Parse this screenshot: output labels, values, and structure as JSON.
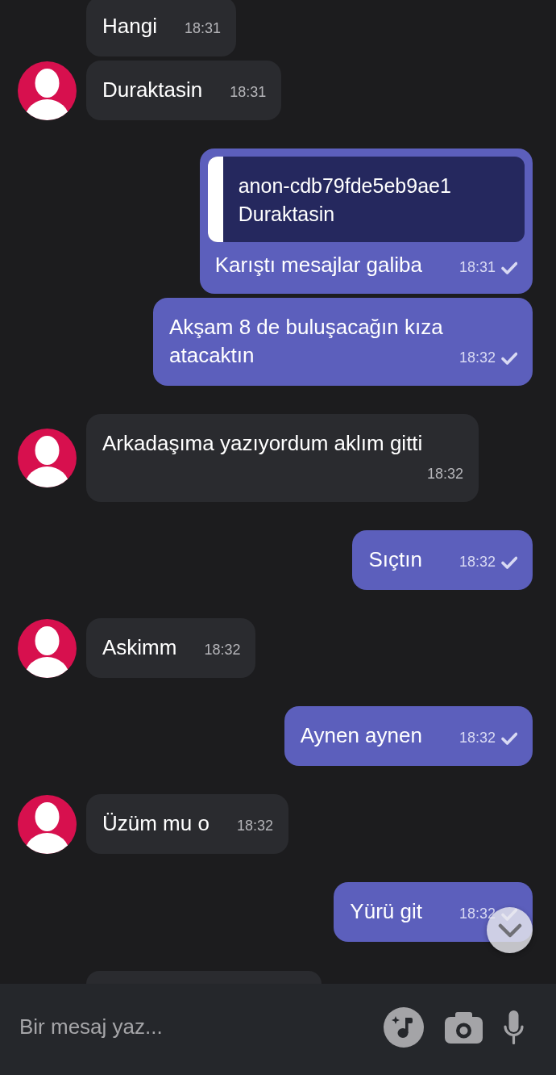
{
  "chat": {
    "groups": [
      {
        "kind": "incoming",
        "messages": [
          {
            "text": "Hangi",
            "time": "18:31"
          },
          {
            "text": "Duraktasin",
            "time": "18:31"
          }
        ]
      },
      {
        "kind": "outgoing",
        "messages": [
          {
            "reply_to": {
              "author": "anon-cdb79fde5eb9ae1",
              "text": "Duraktasin"
            },
            "text": "Karıştı mesajlar galiba",
            "time": "18:31",
            "delivered": true
          },
          {
            "text": "Akşam 8 de buluşacağın kıza atacaktın",
            "time": "18:32",
            "delivered": true
          }
        ]
      },
      {
        "kind": "incoming",
        "messages": [
          {
            "text": "Arkadaşıma yazıyordum aklım gitti",
            "time": "18:32"
          }
        ]
      },
      {
        "kind": "outgoing",
        "messages": [
          {
            "text": "Sıçtın",
            "time": "18:32",
            "delivered": true
          }
        ]
      },
      {
        "kind": "incoming",
        "messages": [
          {
            "text": "Askimm",
            "time": "18:32"
          }
        ]
      },
      {
        "kind": "outgoing",
        "messages": [
          {
            "text": "Aynen aynen",
            "time": "18:32",
            "delivered": true
          }
        ]
      },
      {
        "kind": "incoming",
        "messages": [
          {
            "text": "Üzüm mu o",
            "time": "18:32"
          }
        ]
      },
      {
        "kind": "outgoing",
        "messages": [
          {
            "text": "Yürü git",
            "time": "18:32",
            "delivered": true
          }
        ]
      }
    ]
  },
  "composer": {
    "placeholder": "Bir mesaj yaz..."
  }
}
